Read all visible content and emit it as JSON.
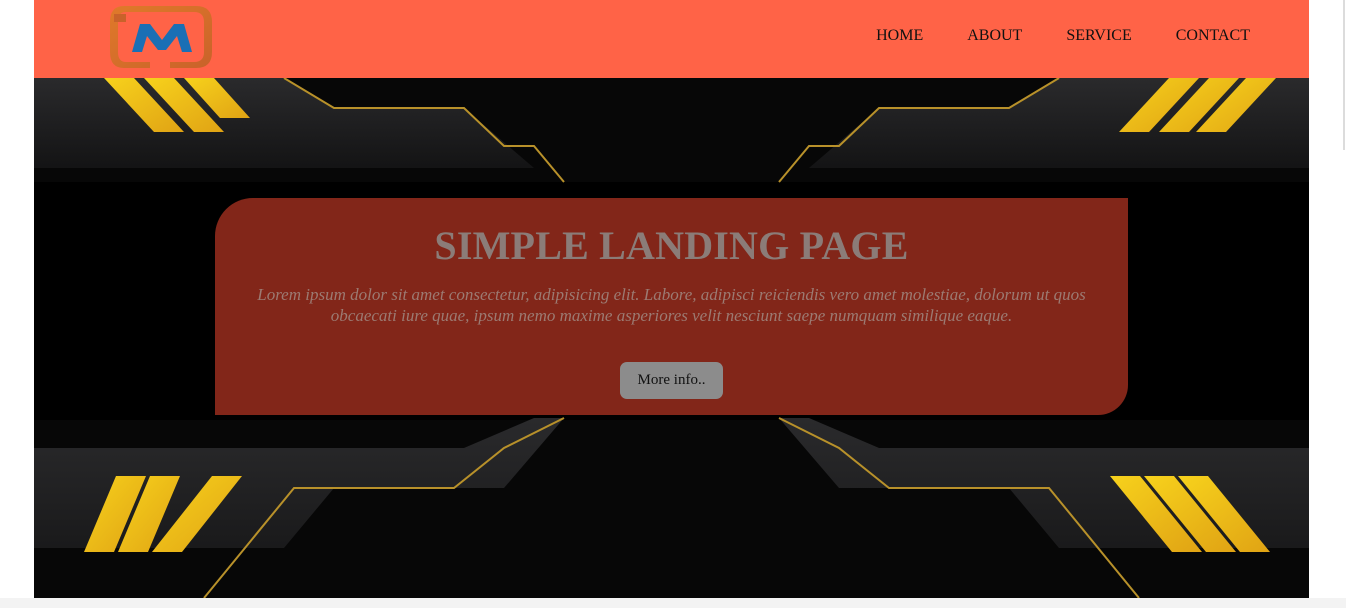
{
  "header": {
    "logo_letter": "M",
    "nav": [
      "HOME",
      "ABOUT",
      "SERVICE",
      "CONTACT"
    ]
  },
  "hero": {
    "title": "SIMPLE LANDING PAGE",
    "text": "Lorem ipsum dolor sit amet consectetur, adipisicing elit. Labore, adipisci reiciendis vero amet molestiae, dolorum ut quos obcaecati iure quae, ipsum nemo maxime asperiores velit nesciunt saepe numquam similique eaque.",
    "button": "More info.."
  },
  "colors": {
    "header_bg": "#ff6347",
    "card_bg": "#b43423",
    "accent_yellow": "#f0c419"
  }
}
